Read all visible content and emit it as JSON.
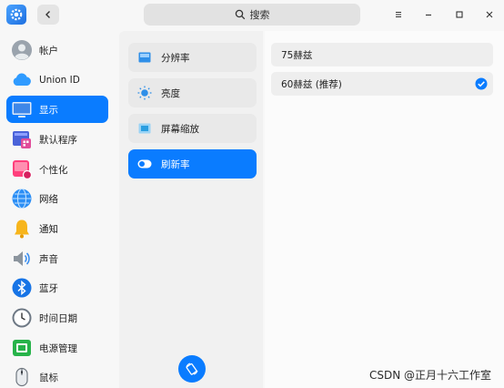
{
  "search": {
    "label": "搜索"
  },
  "sidebar": {
    "items": [
      {
        "label": "帐户",
        "icon": "account-icon"
      },
      {
        "label": "Union ID",
        "icon": "cloud-icon"
      },
      {
        "label": "显示",
        "icon": "display-icon",
        "active": true
      },
      {
        "label": "默认程序",
        "icon": "default-apps-icon"
      },
      {
        "label": "个性化",
        "icon": "personalization-icon"
      },
      {
        "label": "网络",
        "icon": "network-icon"
      },
      {
        "label": "通知",
        "icon": "bell-icon"
      },
      {
        "label": "声音",
        "icon": "speaker-icon"
      },
      {
        "label": "蓝牙",
        "icon": "bluetooth-icon"
      },
      {
        "label": "时间日期",
        "icon": "clock-icon"
      },
      {
        "label": "电源管理",
        "icon": "battery-icon"
      },
      {
        "label": "鼠标",
        "icon": "mouse-icon"
      }
    ]
  },
  "display_menu": {
    "items": [
      {
        "label": "分辨率",
        "icon": "resolution-icon"
      },
      {
        "label": "亮度",
        "icon": "brightness-icon"
      },
      {
        "label": "屏幕缩放",
        "icon": "scale-icon"
      },
      {
        "label": "刷新率",
        "icon": "refresh-rate-icon",
        "active": true
      }
    ],
    "rotate_icon": "rotate-icon"
  },
  "refresh_rates": {
    "options": [
      {
        "label": "75赫兹",
        "selected": false
      },
      {
        "label": "60赫兹 (推荐)",
        "selected": true
      }
    ]
  },
  "watermark": "CSDN @正月十六工作室",
  "colors": {
    "accent": "#0a7cff",
    "sidebar_bg": "#f7f7f7",
    "panel_bg": "#f1f1f1"
  }
}
